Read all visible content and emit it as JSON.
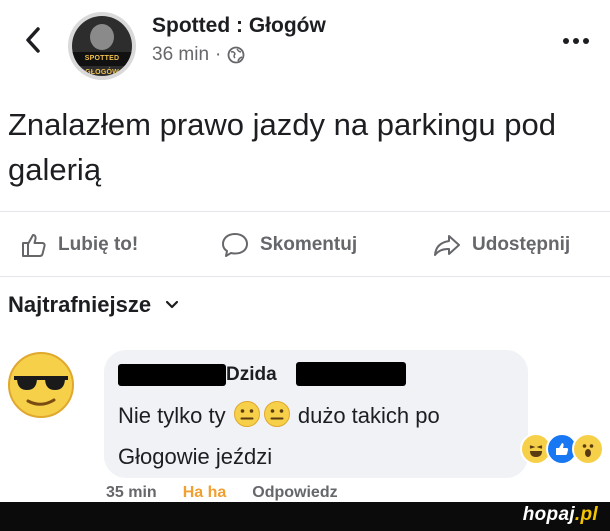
{
  "header": {
    "page_name": "Spotted : Głogów",
    "time": "36 min",
    "separator": "·",
    "avatar_text": "SPOTTED GŁOGÓW",
    "more_icon": "more-dots-icon"
  },
  "post": {
    "text": "Znalazłem prawo jazdy na parkingu pod galerią"
  },
  "actions": {
    "like": "Lubię to!",
    "comment": "Skomentuj",
    "share": "Udostępnij"
  },
  "sort": {
    "label": "Najtrafniejsze"
  },
  "comment": {
    "author": "Dzida",
    "text_part1": "Nie tylko ty",
    "text_part2": "dużo takich po Głogowie jeździ",
    "time": "35 min",
    "reaction_link": "Ha ha",
    "reply_link": "Odpowiedz",
    "reactions": [
      "haha",
      "like",
      "wow"
    ]
  },
  "watermark": {
    "name": "hopaj",
    "tld": ".pl"
  },
  "colors": {
    "text": "#1c1e21",
    "secondary": "#65676b",
    "bubble": "#f0f2f5",
    "like_blue": "#1877f2",
    "emoji_yellow": "#f7d04a"
  }
}
